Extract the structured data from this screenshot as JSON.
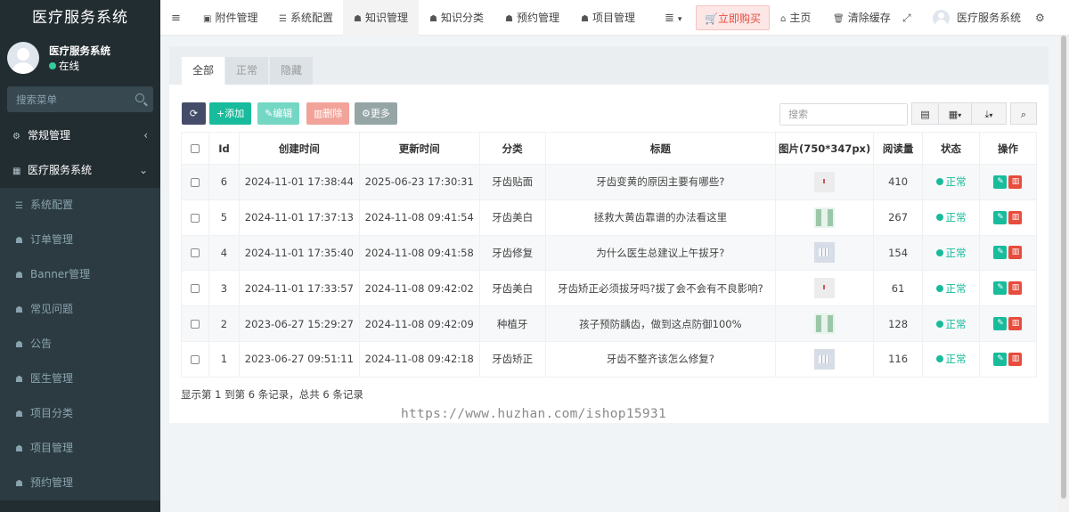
{
  "app": {
    "title": "医疗服务系统",
    "user_name": "医疗服务系统",
    "user_status": "在线"
  },
  "sidebar": {
    "search_placeholder": "搜索菜单",
    "top_items": [
      {
        "label": "常规管理",
        "icon": "gears-icon",
        "arrow": "chevron-left-icon"
      },
      {
        "label": "医疗服务系统",
        "icon": "table-icon",
        "arrow": "chevron-down-icon"
      }
    ],
    "sub_items": [
      {
        "label": "系统配置",
        "icon": "sliders-icon"
      },
      {
        "label": "订单管理",
        "icon": "sitemap-icon"
      },
      {
        "label": "Banner管理",
        "icon": "sitemap-icon"
      },
      {
        "label": "常见问题",
        "icon": "sitemap-icon"
      },
      {
        "label": "公告",
        "icon": "sitemap-icon"
      },
      {
        "label": "医生管理",
        "icon": "sitemap-icon"
      },
      {
        "label": "项目分类",
        "icon": "sitemap-icon"
      },
      {
        "label": "项目管理",
        "icon": "sitemap-icon"
      },
      {
        "label": "预约管理",
        "icon": "sitemap-icon"
      }
    ]
  },
  "navbar": {
    "items": [
      {
        "label": "附件管理",
        "icon": "image-icon"
      },
      {
        "label": "系统配置",
        "icon": "sliders-icon"
      },
      {
        "label": "知识管理",
        "icon": "sitemap-icon"
      },
      {
        "label": "知识分类",
        "icon": "sitemap-icon"
      },
      {
        "label": "预约管理",
        "icon": "sitemap-icon"
      },
      {
        "label": "项目管理",
        "icon": "sitemap-icon"
      }
    ],
    "buy_label": "立即购买",
    "home_label": "主页",
    "clear_cache_label": "清除缓存",
    "user_label": "医疗服务系统"
  },
  "content": {
    "tabs": [
      "全部",
      "正常",
      "隐藏"
    ],
    "active_tab": "全部",
    "toolbar": {
      "add_label": "添加",
      "edit_label": "编辑",
      "delete_label": "删除",
      "more_label": "更多",
      "search_placeholder": "搜索"
    },
    "table": {
      "columns": [
        "Id",
        "创建时间",
        "更新时间",
        "分类",
        "标题",
        "图片(750*347px)",
        "阅读量",
        "状态",
        "操作"
      ],
      "rows": [
        {
          "id": "6",
          "created": "2024-11-01 17:38:44",
          "updated": "2025-06-23 17:30:31",
          "category": "牙齿贴面",
          "title": "牙齿变黄的原因主要有哪些?",
          "views": "410",
          "status": "正常"
        },
        {
          "id": "5",
          "created": "2024-11-01 17:37:13",
          "updated": "2024-11-08 09:41:54",
          "category": "牙齿美白",
          "title": "拯救大黄齿靠谱的办法看这里",
          "views": "267",
          "status": "正常"
        },
        {
          "id": "4",
          "created": "2024-11-01 17:35:40",
          "updated": "2024-11-08 09:41:58",
          "category": "牙齿修复",
          "title": "为什么医生总建议上午拔牙?",
          "views": "154",
          "status": "正常"
        },
        {
          "id": "3",
          "created": "2024-11-01 17:33:57",
          "updated": "2024-11-08 09:42:02",
          "category": "牙齿美白",
          "title": "牙齿矫正必须拔牙吗?拔了会不会有不良影响?",
          "views": "61",
          "status": "正常"
        },
        {
          "id": "2",
          "created": "2023-06-27 15:29:27",
          "updated": "2024-11-08 09:42:09",
          "category": "种植牙",
          "title": "孩子预防龋齿，做到这点防御100%",
          "views": "128",
          "status": "正常"
        },
        {
          "id": "1",
          "created": "2023-06-27 09:51:11",
          "updated": "2024-11-08 09:42:18",
          "category": "牙齿矫正",
          "title": "牙齿不整齐该怎么修复?",
          "views": "116",
          "status": "正常"
        }
      ]
    },
    "summary": "显示第 1 到第 6 条记录，总共 6 条记录"
  },
  "watermark_text": "https://www.huzhan.com/ishop15931",
  "colors": {
    "sidebar_bg": "#222d32",
    "primary": "#18bc9c",
    "danger": "#e74c3c",
    "dark_btn": "#444c69"
  }
}
